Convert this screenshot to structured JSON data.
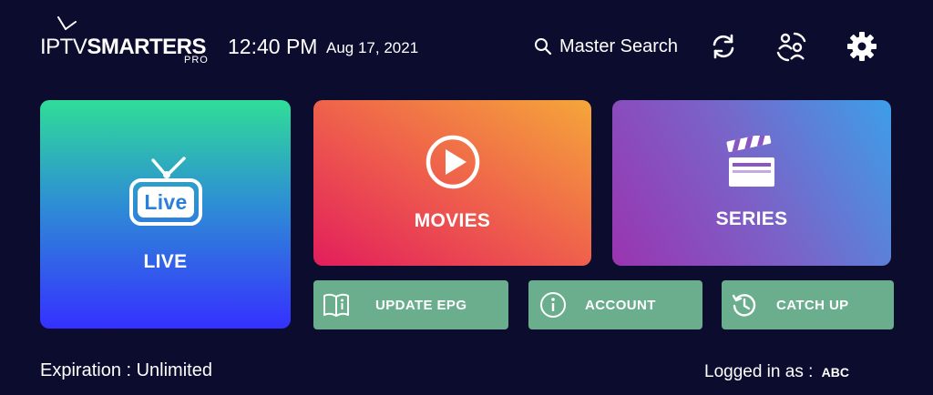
{
  "header": {
    "logo": {
      "part1": "IPTV",
      "part2": "SMARTERS",
      "part3": "PRO"
    },
    "time": "12:40 PM",
    "date": "Aug 17, 2021",
    "search_label": "Master Search",
    "icons": [
      "refresh-icon",
      "switch-user-icon",
      "settings-icon"
    ]
  },
  "tiles": {
    "live": {
      "label": "LIVE",
      "badge": "Live"
    },
    "movies": {
      "label": "MOVIES"
    },
    "series": {
      "label": "SERIES"
    }
  },
  "buttons": {
    "update_epg": "UPDATE EPG",
    "account": "ACCOUNT",
    "catch_up": "CATCH UP"
  },
  "footer": {
    "expiration": "Expiration : Unlimited",
    "logged_in_label": "Logged in as :",
    "username": "ABC"
  },
  "colors": {
    "background": "#0c0c2e",
    "button_green": "#6aae8d"
  }
}
